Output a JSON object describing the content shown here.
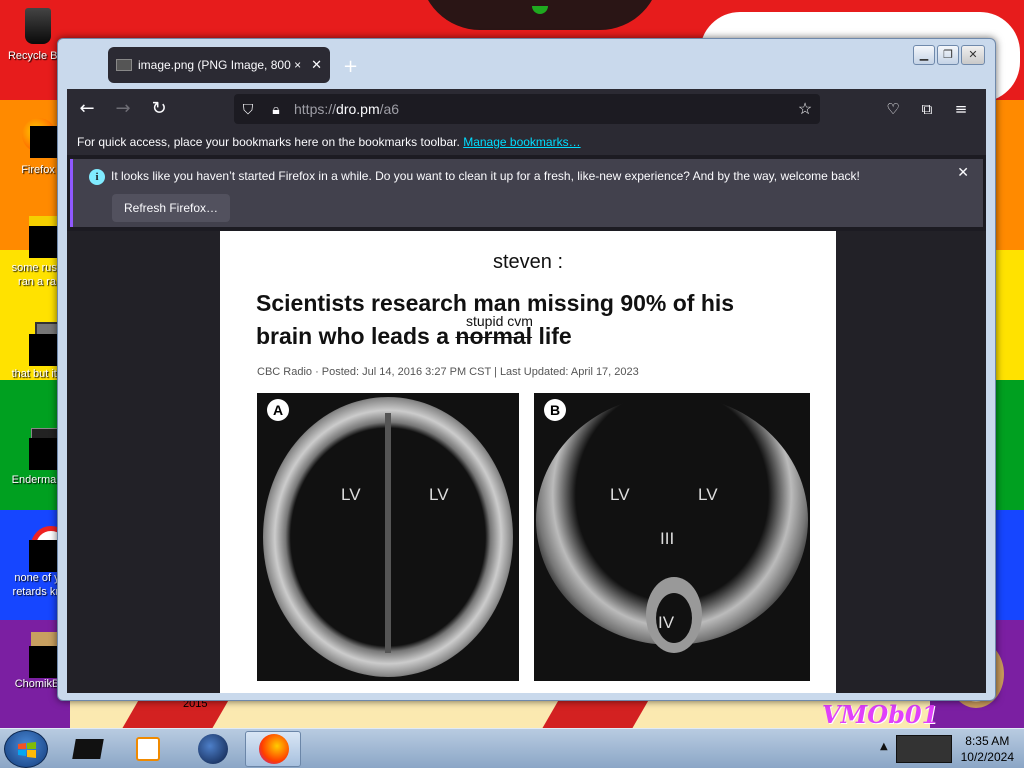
{
  "desktop": {
    "icons": [
      {
        "label": "Recycle Bin",
        "icon": "recycle-bin-icon"
      },
      {
        "label": "Firefox",
        "icon": "firefox-icon"
      },
      {
        "label": "some russ",
        "label2": "ran a ra",
        "icon": "file-icon"
      },
      {
        "label": "that but its",
        "icon": "folder-icon"
      },
      {
        "label": "Enderman",
        "icon": "program-icon"
      },
      {
        "label": "none of y",
        "label2": "retards kn",
        "icon": "opera-icon"
      },
      {
        "label": "ChomikB",
        "icon": "hamster-icon"
      }
    ],
    "wallpaper_text": "VMOb01",
    "wallpaper_small_text": "2015"
  },
  "window": {
    "tab_title": "image.png (PNG Image, 800 × …",
    "new_tab": "+",
    "url_scheme": "https://",
    "url_host": "dro.pm",
    "url_path": "/a6",
    "bookmarks_text": "For quick access, place your bookmarks here on the bookmarks toolbar.",
    "bookmarks_link": "Manage bookmarks…",
    "notice_text": "It looks like you haven’t started Firefox in a while. Do you want to clean it up for a fresh, like-new experience? And by the way, welcome back!",
    "refresh_button": "Refresh Firefox…"
  },
  "image": {
    "author": "steven :",
    "headline_line1": "Scientists research man missing 90% of his",
    "headline_line2_pre": "brain who leads a ",
    "headline_struck": "normal",
    "headline_line2_post": " life",
    "handwritten": "stupid cvm",
    "byline": "CBC Radio · Posted: Jul 14, 2016 3:27 PM CST | Last Updated: April 17, 2023",
    "scan_a": {
      "letter": "A",
      "labels": [
        "LV",
        "LV"
      ]
    },
    "scan_b": {
      "letter": "B",
      "labels": [
        "LV",
        "LV",
        "III",
        "IV"
      ]
    }
  },
  "taskbar": {
    "time": "8:35 AM",
    "date": "10/2/2024"
  },
  "colors": {
    "firefox_dark": "#2b2a33",
    "link": "#00ddff",
    "notice_accent": "#9059ff"
  }
}
